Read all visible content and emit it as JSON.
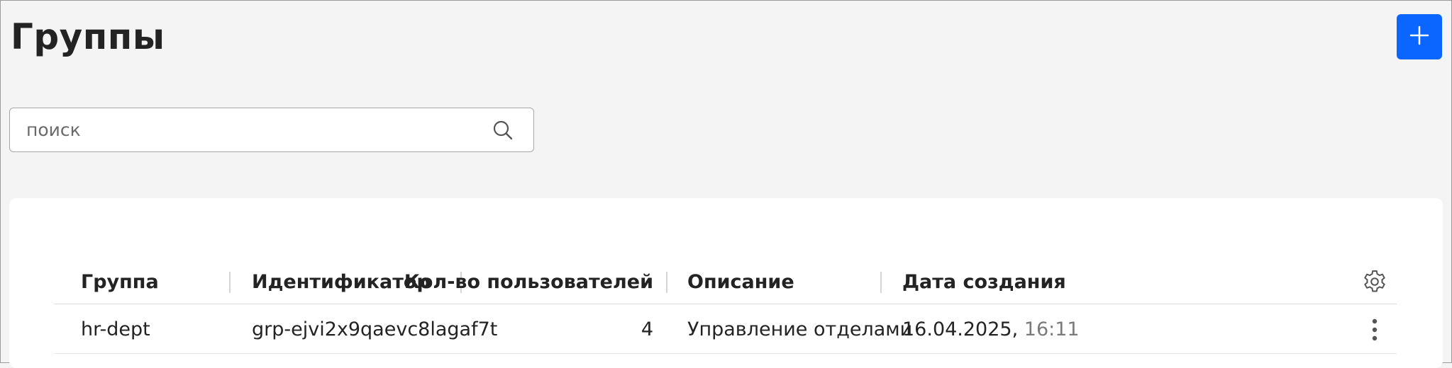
{
  "header": {
    "title": "Группы",
    "add_button_icon": "plus-icon"
  },
  "search": {
    "placeholder": "поиск",
    "value": "",
    "icon": "search-icon"
  },
  "table": {
    "columns": [
      "Группа",
      "Идентификатор",
      "Кол-во пользователей",
      "Описание",
      "Дата создания"
    ],
    "settings_icon": "gear-icon",
    "rows": [
      {
        "group": "hr-dept",
        "id": "grp-ejvi2x9qaevc8lagaf7t",
        "users": "4",
        "description": "Управление отделами",
        "date": "16.04.2025,",
        "time": "16:11",
        "actions_icon": "more-vertical-icon"
      }
    ]
  },
  "colors": {
    "accent": "#0a66ff",
    "background": "#f4f4f4",
    "card": "#ffffff",
    "text": "#232323",
    "muted": "#7a7a7a"
  }
}
